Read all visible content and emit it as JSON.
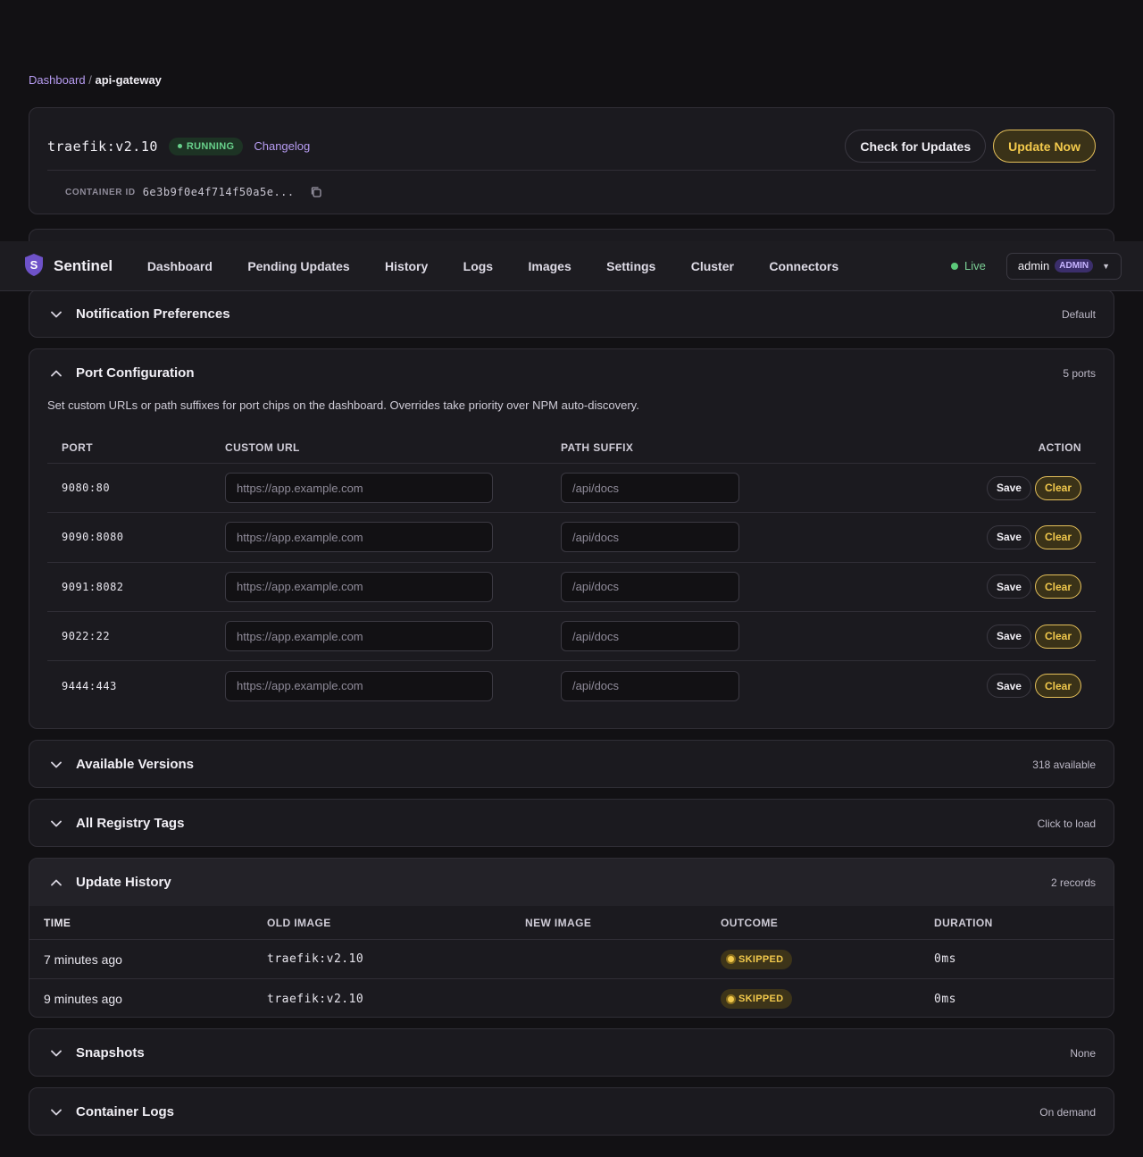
{
  "breadcrumb": {
    "parent": "Dashboard",
    "separator": "/",
    "current": "api-gateway"
  },
  "container": {
    "image": "traefik:v2.10",
    "status": "RUNNING",
    "changelog_label": "Changelog",
    "check_updates_label": "Check for Updates",
    "update_now_label": "Update Now",
    "id_label": "CONTAINER ID",
    "id_value": "6e3b9f0e4f714f50a5e..."
  },
  "navbar": {
    "brand_letter": "S",
    "brand_name": "Sentinel",
    "items": [
      "Dashboard",
      "Pending Updates",
      "History",
      "Logs",
      "Images",
      "Settings",
      "Cluster",
      "Connectors"
    ],
    "live_label": "Live",
    "user": "admin",
    "role": "ADMIN"
  },
  "sections": {
    "notifications": {
      "title": "Notification Preferences",
      "meta": "Default"
    },
    "ports": {
      "title": "Port Configuration",
      "meta": "5 ports",
      "description": "Set custom URLs or path suffixes for port chips on the dashboard. Overrides take priority over NPM auto-discovery.",
      "headers": {
        "port": "PORT",
        "url": "CUSTOM URL",
        "path": "PATH SUFFIX",
        "action": "ACTION"
      },
      "url_placeholder": "https://app.example.com",
      "path_placeholder": "/api/docs",
      "save_label": "Save",
      "clear_label": "Clear",
      "rows": [
        "9080:80",
        "9090:8080",
        "9091:8082",
        "9022:22",
        "9444:443"
      ]
    },
    "versions": {
      "title": "Available Versions",
      "meta": "318 available"
    },
    "tags": {
      "title": "All Registry Tags",
      "meta": "Click to load"
    },
    "history": {
      "title": "Update History",
      "meta": "2 records",
      "headers": {
        "time": "TIME",
        "old": "OLD IMAGE",
        "new": "NEW IMAGE",
        "outcome": "OUTCOME",
        "duration": "DURATION"
      },
      "rows": [
        {
          "time": "7 minutes ago",
          "old": "traefik:v2.10",
          "new": "",
          "outcome": "SKIPPED",
          "duration": "0ms"
        },
        {
          "time": "9 minutes ago",
          "old": "traefik:v2.10",
          "new": "",
          "outcome": "SKIPPED",
          "duration": "0ms"
        }
      ]
    },
    "snapshots": {
      "title": "Snapshots",
      "meta": "None"
    },
    "logs": {
      "title": "Container Logs",
      "meta": "On demand"
    }
  },
  "colors": {
    "accent": "#b79cf2",
    "warning": "#f2c94c",
    "success": "#68d18b",
    "background": "#121114",
    "card": "#1b1a1f"
  }
}
